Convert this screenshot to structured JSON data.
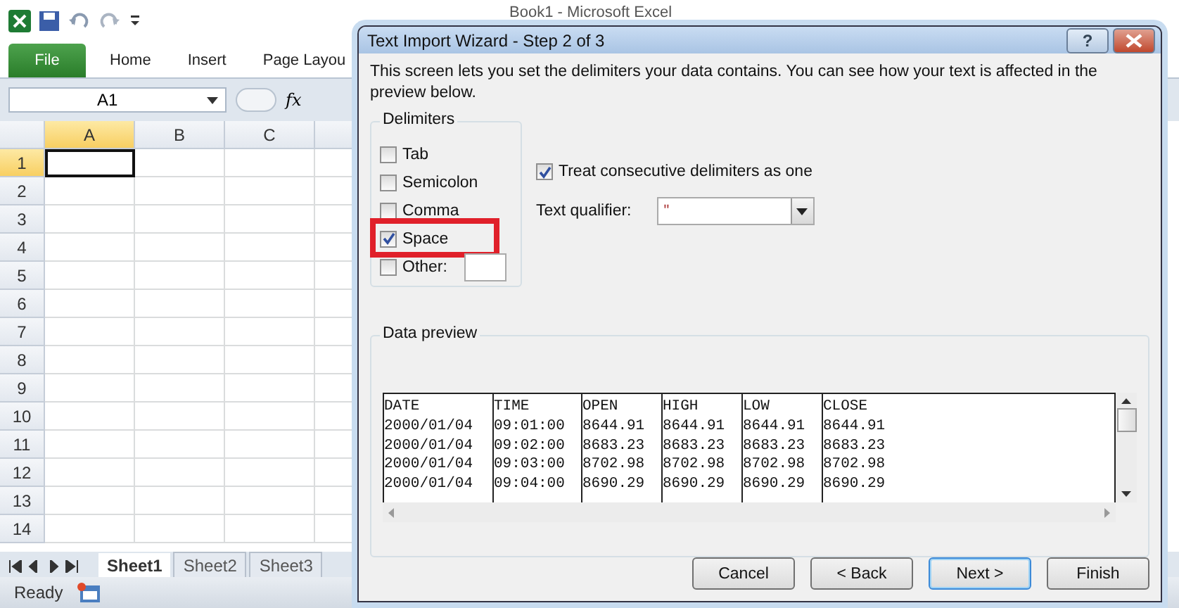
{
  "excel": {
    "title": "Book1  -  Microsoft Excel",
    "ribbon_tabs": [
      {
        "label": "File",
        "kind": "file"
      },
      {
        "label": "Home",
        "kind": "tab"
      },
      {
        "label": "Insert",
        "kind": "tab"
      },
      {
        "label": "Page Layou",
        "kind": "tab"
      }
    ],
    "name_box": "A1",
    "formula_icon": "fx",
    "columns": [
      {
        "label": "A",
        "selected": true
      },
      {
        "label": "B",
        "selected": false
      },
      {
        "label": "C",
        "selected": false
      }
    ],
    "rows": [
      {
        "label": "1",
        "selected": true
      },
      {
        "label": "2",
        "selected": false
      },
      {
        "label": "3",
        "selected": false
      },
      {
        "label": "4",
        "selected": false
      },
      {
        "label": "5",
        "selected": false
      },
      {
        "label": "6",
        "selected": false
      },
      {
        "label": "7",
        "selected": false
      },
      {
        "label": "8",
        "selected": false
      },
      {
        "label": "9",
        "selected": false
      },
      {
        "label": "10",
        "selected": false
      },
      {
        "label": "11",
        "selected": false
      },
      {
        "label": "12",
        "selected": false
      },
      {
        "label": "13",
        "selected": false
      },
      {
        "label": "14",
        "selected": false
      }
    ],
    "sheet_tabs": [
      {
        "label": "Sheet1",
        "selected": true
      },
      {
        "label": "Sheet2",
        "selected": false
      },
      {
        "label": "Sheet3",
        "selected": false
      }
    ],
    "status": "Ready"
  },
  "dialog": {
    "title": "Text Import Wizard - Step 2 of 3",
    "help": "?",
    "description": "This screen lets you set the delimiters your data contains.  You can see how your text is affected in the preview below.",
    "delimiters_label": "Delimiters",
    "delimiters": [
      {
        "label": "Tab",
        "checked": false,
        "highlighted": false
      },
      {
        "label": "Semicolon",
        "checked": false,
        "highlighted": false
      },
      {
        "label": "Comma",
        "checked": false,
        "highlighted": false
      },
      {
        "label": "Space",
        "checked": true,
        "highlighted": true
      },
      {
        "label": "Other:",
        "checked": false,
        "highlighted": false
      }
    ],
    "treat_consecutive": {
      "label": "Treat consecutive delimiters as one",
      "checked": true
    },
    "qualifier": {
      "label": "Text qualifier:",
      "value": "\""
    },
    "preview_label": "Data preview",
    "preview": [
      [
        "DATE",
        "TIME",
        "OPEN",
        "HIGH",
        "LOW",
        "CLOSE"
      ],
      [
        "2000/01/04",
        "09:01:00",
        "8644.91",
        "8644.91",
        "8644.91",
        "8644.91"
      ],
      [
        "2000/01/04",
        "09:02:00",
        "8683.23",
        "8683.23",
        "8683.23",
        "8683.23"
      ],
      [
        "2000/01/04",
        "09:03:00",
        "8702.98",
        "8702.98",
        "8702.98",
        "8702.98"
      ],
      [
        "2000/01/04",
        "09:04:00",
        "8690.29",
        "8690.29",
        "8690.29",
        "8690.29"
      ]
    ],
    "buttons": [
      {
        "label": "Cancel",
        "selected": false
      },
      {
        "label": "< Back",
        "selected": false
      },
      {
        "label": "Next >",
        "selected": true
      },
      {
        "label": "Finish",
        "selected": false
      }
    ]
  }
}
